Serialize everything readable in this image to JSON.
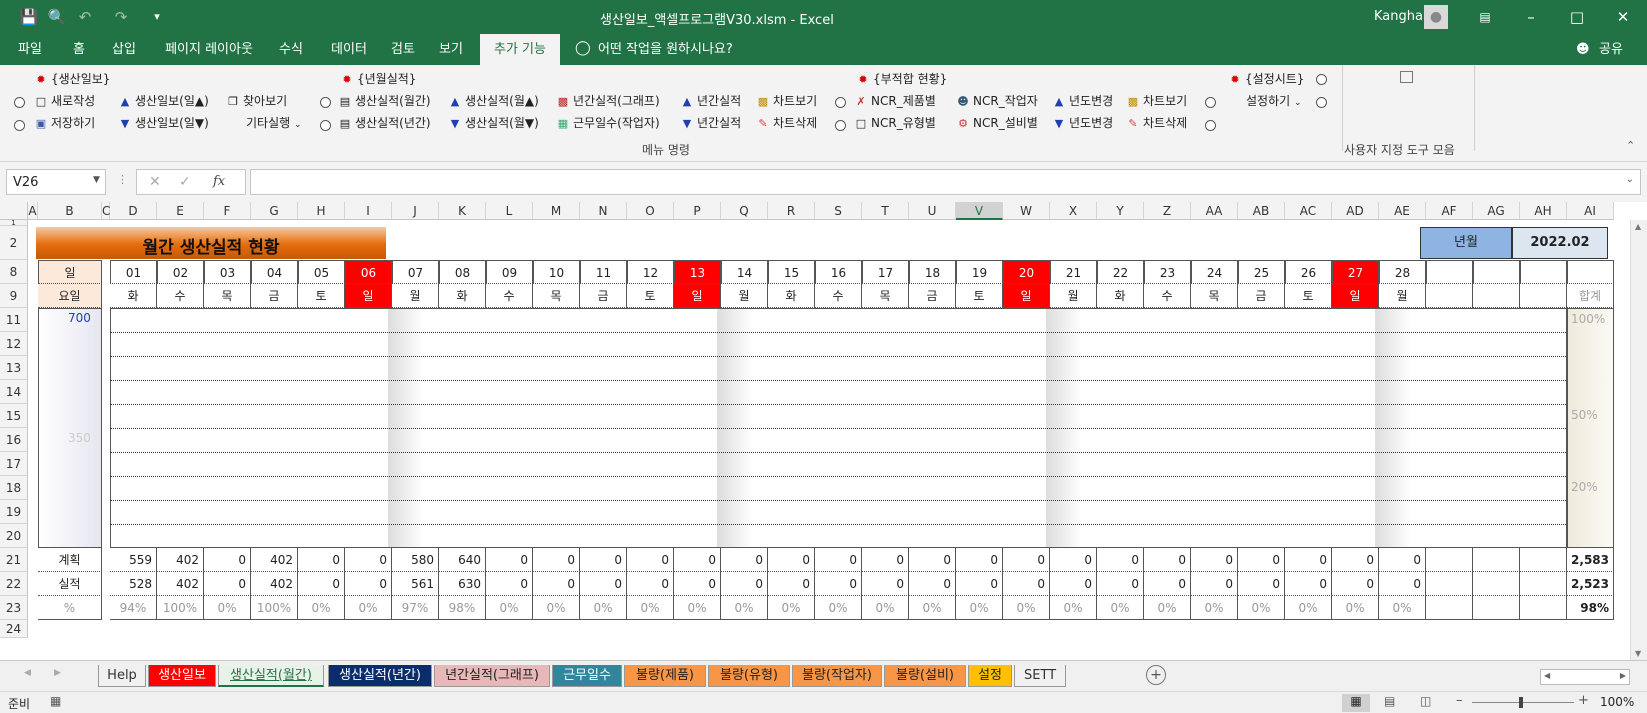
{
  "window": {
    "title": "생산일보_액셀프로그램V30.xlsm  -  Excel",
    "user": "Kangha"
  },
  "tabs": [
    "파일",
    "홈",
    "삽입",
    "페이지 레이아웃",
    "수식",
    "데이터",
    "검토",
    "보기",
    "추가 기능"
  ],
  "tell_me": "어떤 작업을 원하시나요?",
  "share": "공유",
  "ribbon": {
    "g1_title": "{생산일보}",
    "new": "새로작성",
    "save": "저장하기",
    "daily_up": "생산일보(일▲)",
    "daily_dn": "생산일보(일▼)",
    "find": "찾아보기",
    "other": "기타실행",
    "g2_title": "{년월실적}",
    "m_month": "생산실적(월간)",
    "m_year": "생산실적(년간)",
    "m_up": "생산실적(월▲)",
    "m_dn": "생산실적(월▼)",
    "y_graph": "년간실적(그래프)",
    "workdays": "근무일수(작업자)",
    "y_up": "년간실적",
    "y_dn": "년간실적",
    "chart_view": "차트보기",
    "chart_del": "차트삭제",
    "g3_title": "{부적합 현황}",
    "ncr_prod": "NCR_제품별",
    "ncr_type": "NCR_유형별",
    "ncr_worker": "NCR_작업자",
    "ncr_equip": "NCR_설비별",
    "yr_up": "년도변경",
    "yr_dn": "년도변경",
    "chart_view2": "차트보기",
    "chart_del2": "차트삭제",
    "g4_title": "{설정시트}",
    "settings": "설정하기",
    "menu_group": "메뉴 명령",
    "custom_group": "사용자 지정 도구 모음"
  },
  "formula": {
    "namebox": "V26",
    "fx": "fx",
    "content": ""
  },
  "columns": [
    "A",
    "B",
    "C",
    "D",
    "E",
    "F",
    "G",
    "H",
    "I",
    "J",
    "K",
    "L",
    "M",
    "N",
    "O",
    "P",
    "Q",
    "R",
    "S",
    "T",
    "U",
    "V",
    "W",
    "X",
    "Y",
    "Z",
    "AA",
    "AB",
    "AC",
    "AD",
    "AE",
    "AF",
    "AG",
    "AH",
    "AI"
  ],
  "rows": [
    "1",
    "2",
    "8",
    "9",
    "11",
    "12",
    "13",
    "14",
    "15",
    "16",
    "17",
    "18",
    "19",
    "20",
    "21",
    "22",
    "23",
    "24"
  ],
  "sheet": {
    "title": "월간 생산실적 현황",
    "ym_label": "년월",
    "ym_value": "2022.02",
    "day_label": "일",
    "weekday_label": "요일",
    "days": [
      "01",
      "02",
      "03",
      "04",
      "05",
      "06",
      "07",
      "08",
      "09",
      "10",
      "11",
      "12",
      "13",
      "14",
      "15",
      "16",
      "17",
      "18",
      "19",
      "20",
      "21",
      "22",
      "23",
      "24",
      "25",
      "26",
      "27",
      "28",
      "",
      "",
      ""
    ],
    "weekdays": [
      "화",
      "수",
      "목",
      "금",
      "토",
      "일",
      "월",
      "화",
      "수",
      "목",
      "금",
      "토",
      "일",
      "월",
      "화",
      "수",
      "목",
      "금",
      "토",
      "일",
      "월",
      "화",
      "수",
      "목",
      "금",
      "토",
      "일",
      "월",
      "",
      "",
      ""
    ],
    "sum_label": "합계",
    "axis_left_top": "700",
    "axis_left_mid": "350",
    "axis_right": [
      "100%",
      "50%",
      "20%"
    ],
    "plan_label": "계획",
    "actual_label": "실적",
    "pct_label": "%",
    "plan": [
      "559",
      "402",
      "0",
      "402",
      "0",
      "0",
      "580",
      "640",
      "0",
      "0",
      "0",
      "0",
      "0",
      "0",
      "0",
      "0",
      "0",
      "0",
      "0",
      "0",
      "0",
      "0",
      "0",
      "0",
      "0",
      "0",
      "0",
      "0",
      "",
      "",
      ""
    ],
    "actual": [
      "528",
      "402",
      "0",
      "402",
      "0",
      "0",
      "561",
      "630",
      "0",
      "0",
      "0",
      "0",
      "0",
      "0",
      "0",
      "0",
      "0",
      "0",
      "0",
      "0",
      "0",
      "0",
      "0",
      "0",
      "0",
      "0",
      "0",
      "0",
      "",
      "",
      ""
    ],
    "pct": [
      "94%",
      "100%",
      "0%",
      "100%",
      "0%",
      "0%",
      "97%",
      "98%",
      "0%",
      "0%",
      "0%",
      "0%",
      "0%",
      "0%",
      "0%",
      "0%",
      "0%",
      "0%",
      "0%",
      "0%",
      "0%",
      "0%",
      "0%",
      "0%",
      "0%",
      "0%",
      "0%",
      "0%",
      "",
      "",
      ""
    ],
    "plan_total": "2,583",
    "actual_total": "2,523",
    "pct_total": "98%"
  },
  "sheet_tabs": [
    "Help",
    "생산일보",
    "생산실적(월간)",
    "생산실적(년간)",
    "년간실적(그래프)",
    "근무일수",
    "불량(제품)",
    "불량(유형)",
    "불량(작업자)",
    "불량(설비)",
    "설정",
    "SETT"
  ],
  "status": {
    "ready": "준비",
    "zoom": "100%"
  },
  "colors": {
    "excel_green": "#217346",
    "sunday_red": "#ff0000",
    "title_orange": "#e46c0a"
  }
}
